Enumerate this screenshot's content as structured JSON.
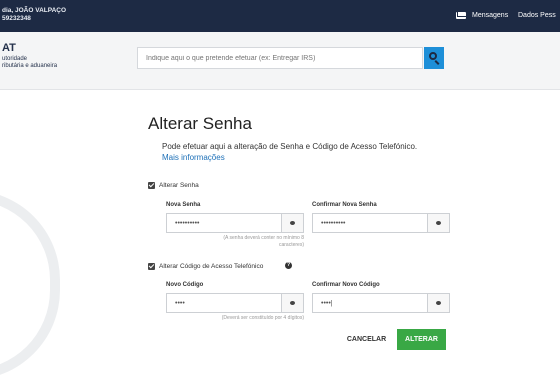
{
  "topbar": {
    "user_line1": "dia, JOÃO VALPAÇO",
    "user_line2": "59232348",
    "nav": [
      "Mensagens",
      "Dados Pess"
    ]
  },
  "header": {
    "logo_title": "AT",
    "logo_sub1": "utoridade",
    "logo_sub2": "ributária e aduaneira",
    "search_placeholder": "Indique aqui o que pretende efetuar (ex: Entregar IRS)"
  },
  "main": {
    "title": "Alterar Senha",
    "description": "Pode efetuar aqui a alteração de Senha e Código de Acesso Telefónico.",
    "more_link": "Mais informações",
    "senha_section": {
      "checkbox_label": "Alterar Senha",
      "new_label": "Nova Senha",
      "new_value": "••••••••••",
      "confirm_label": "Confirmar Nova Senha",
      "confirm_value": "••••••••••",
      "hint_line1": "(A senha deverá conter no mínimo 8",
      "hint_line2": "caracteres)"
    },
    "codigo_section": {
      "checkbox_label": "Alterar Código de Acesso Telefónico",
      "new_label": "Novo Código",
      "new_value": "••••",
      "confirm_label": "Confirmar Novo Código",
      "confirm_value": "••••|",
      "hint": "(Deverá ser constituído por 4 dígitos)"
    },
    "cancel_label": "CANCELAR",
    "submit_label": "ALTERAR"
  },
  "colors": {
    "topbar": "#1d2a44",
    "accent": "#1d8fd8",
    "submit": "#39a845",
    "link": "#1d70b8"
  }
}
